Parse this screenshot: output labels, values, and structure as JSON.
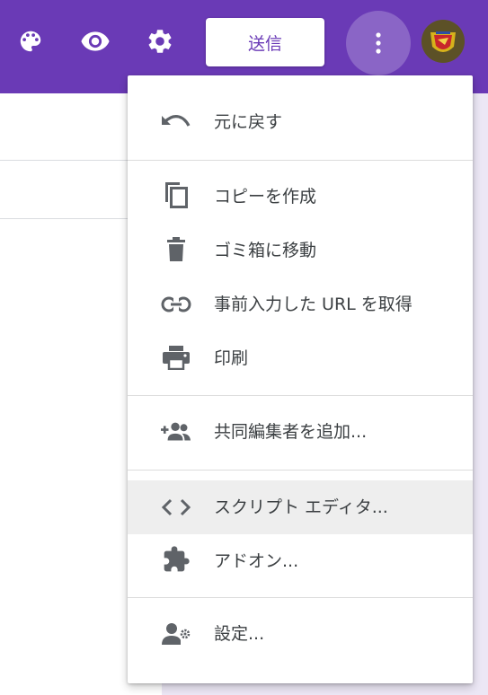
{
  "header": {
    "send_label": "送信",
    "icons": [
      "palette-icon",
      "eye-icon",
      "gear-icon",
      "more-vert-icon"
    ],
    "color": "#6a3ab6"
  },
  "menu": {
    "undo": "元に戻す",
    "copy": "コピーを作成",
    "trash": "ゴミ箱に移動",
    "prefill_url": "事前入力した URL を取得",
    "print": "印刷",
    "add_collaborators": "共同編集者を追加...",
    "script_editor": "スクリプト エディタ...",
    "addons": "アドオン...",
    "settings": "設定..."
  }
}
